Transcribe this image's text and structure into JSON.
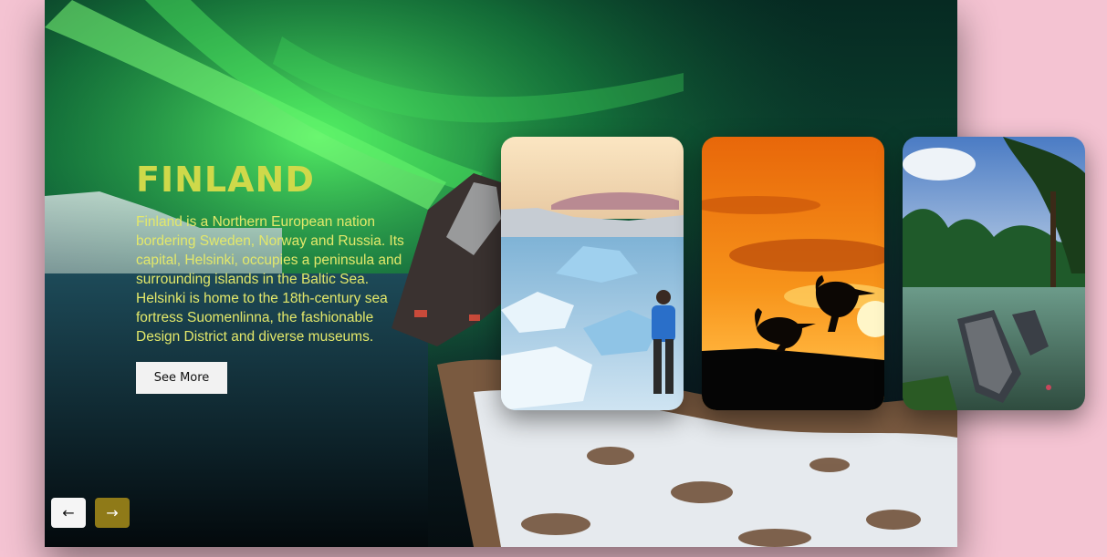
{
  "hero": {
    "title": "FINLAND",
    "description": "Finland is a Northern European nation bordering Sweden, Norway and Russia. Its capital, Helsinki, occupies a peninsula and surrounding islands in the Baltic Sea. Helsinki is home to the 18th-century sea fortress Suomenlinna, the fashionable Design District and diverse museums.",
    "button_label": "See More",
    "background_icon": "aurora-landscape-image"
  },
  "cards": [
    {
      "image": "glacier-lagoon-hiker-image"
    },
    {
      "image": "kangaroo-sunset-image"
    },
    {
      "image": "tropical-backwater-boats-image"
    }
  ],
  "nav": {
    "prev_icon": "arrow-left-icon",
    "next_icon": "arrow-right-icon",
    "prev_glyph": "←",
    "next_glyph": "→"
  },
  "colors": {
    "page_background": "#f4c3d2",
    "title": "#cfd94a",
    "description": "#e3e86a",
    "next_button": "#8f7a18"
  }
}
